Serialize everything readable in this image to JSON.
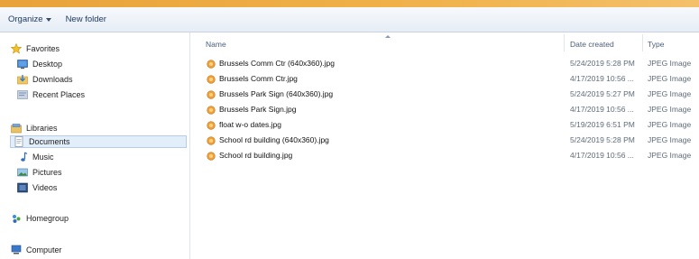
{
  "toolbar": {
    "organize_label": "Organize",
    "new_folder_label": "New folder"
  },
  "nav": {
    "favorites_label": "Favorites",
    "favorites": [
      "Desktop",
      "Downloads",
      "Recent Places"
    ],
    "libraries_label": "Libraries",
    "libraries": [
      "Documents",
      "Music",
      "Pictures",
      "Videos"
    ],
    "selected": "Documents",
    "homegroup_label": "Homegroup",
    "computer_label": "Computer"
  },
  "columns": {
    "name": "Name",
    "date_created": "Date created",
    "type": "Type"
  },
  "files": [
    {
      "name": "Brussels Comm Ctr (640x360).jpg",
      "date": "5/24/2019 5:28 PM",
      "type": "JPEG Image"
    },
    {
      "name": "Brussels Comm Ctr.jpg",
      "date": "4/17/2019 10:56 ...",
      "type": "JPEG Image"
    },
    {
      "name": "Brussels Park Sign (640x360).jpg",
      "date": "5/24/2019 5:27 PM",
      "type": "JPEG Image"
    },
    {
      "name": "Brussels Park Sign.jpg",
      "date": "4/17/2019 10:56 ...",
      "type": "JPEG Image"
    },
    {
      "name": "float w-o dates.jpg",
      "date": "5/19/2019 6:51 PM",
      "type": "JPEG Image"
    },
    {
      "name": "School rd building (640x360).jpg",
      "date": "5/24/2019 5:28 PM",
      "type": "JPEG Image"
    },
    {
      "name": "School rd building.jpg",
      "date": "4/17/2019 10:56 ...",
      "type": "JPEG Image"
    }
  ],
  "colors": {
    "accent": "#f0b24a",
    "selection": "#e3eefb",
    "toolbar_text": "#1e3b62"
  }
}
